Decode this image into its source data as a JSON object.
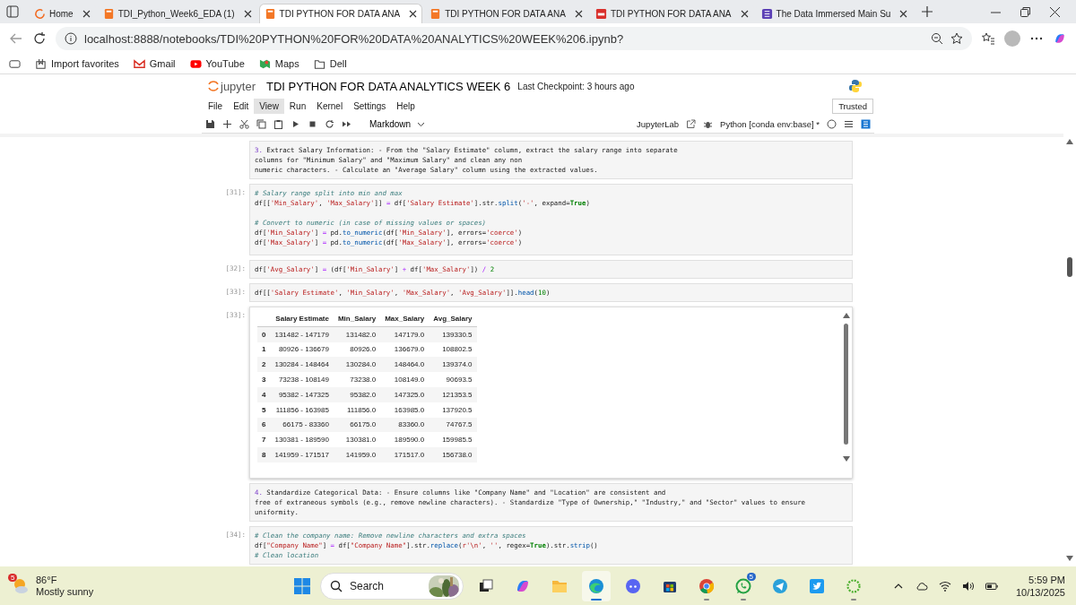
{
  "browser": {
    "tabs": [
      {
        "title": "Home",
        "kind": "home",
        "selected": false
      },
      {
        "title": "TDI_Python_Week6_EDA (1)",
        "kind": "notebook",
        "selected": false
      },
      {
        "title": "TDI PYTHON FOR DATA ANA",
        "kind": "notebook",
        "selected": true
      },
      {
        "title": "TDI PYTHON FOR DATA ANA",
        "kind": "notebook",
        "selected": false
      },
      {
        "title": "TDI PYTHON FOR DATA ANA",
        "kind": "pdf",
        "selected": false
      },
      {
        "title": "The Data Immersed Main Su",
        "kind": "doc",
        "selected": false
      }
    ],
    "url": "localhost:8888/notebooks/TDI%20PYTHON%20FOR%20DATA%20ANALYTICS%20WEEK%206.ipynb?",
    "favorites": [
      {
        "label": "Import favorites",
        "kind": "import"
      },
      {
        "label": "Gmail",
        "kind": "gmail"
      },
      {
        "label": "YouTube",
        "kind": "youtube"
      },
      {
        "label": "Maps",
        "kind": "maps"
      },
      {
        "label": "Dell",
        "kind": "folder"
      }
    ]
  },
  "jupyter": {
    "logo": "jupyter",
    "title": "TDI PYTHON FOR DATA ANALYTICS WEEK 6",
    "checkpoint": "Last Checkpoint: 3 hours ago",
    "menu": [
      {
        "label": "File",
        "selected": false
      },
      {
        "label": "Edit",
        "selected": false
      },
      {
        "label": "View",
        "selected": true
      },
      {
        "label": "Run",
        "selected": false
      },
      {
        "label": "Kernel",
        "selected": false
      },
      {
        "label": "Settings",
        "selected": false
      },
      {
        "label": "Help",
        "selected": false
      }
    ],
    "trusted": "Trusted",
    "cell_type": "Markdown",
    "open_in": "JupyterLab",
    "kernel": "Python [conda env:base] *"
  },
  "cells": [
    {
      "kind": "markdown",
      "lines": [
        "3. Extract Salary Information: - From the \"Salary Estimate\" column, extract the salary range into separate",
        "columns for \"Minimum Salary\" and \"Maximum Salary\" and clean any non",
        "numeric characters. - Calculate an \"Average Salary\" column using the extracted values."
      ]
    },
    {
      "kind": "code",
      "prompt": "[31]:",
      "groups": [
        [
          "# Salary range split into min and max",
          "df[['Min_Salary', 'Max_Salary']] = df['Salary Estimate'].str.split('-', expand=True)"
        ],
        [
          "# Convert to numeric (in case of missing values or spaces)",
          "df['Min_Salary'] = pd.to_numeric(df['Min_Salary'], errors='coerce')",
          "df['Max_Salary'] = pd.to_numeric(df['Max_Salary'], errors='coerce')"
        ]
      ]
    },
    {
      "kind": "code",
      "prompt": "[32]:",
      "groups": [
        [
          "df['Avg_Salary'] = (df['Min_Salary'] + df['Max_Salary']) / 2"
        ]
      ]
    },
    {
      "kind": "code",
      "prompt": "[33]:",
      "groups": [
        [
          "df[['Salary Estimate', 'Min_Salary', 'Max_Salary', 'Avg_Salary']].head(10)"
        ]
      ]
    },
    {
      "kind": "table",
      "prompt": "[33]:",
      "columns": [
        "",
        "Salary Estimate",
        "Min_Salary",
        "Max_Salary",
        "Avg_Salary"
      ],
      "rows": [
        [
          "0",
          "131482 - 147179",
          "131482.0",
          "147179.0",
          "139330.5"
        ],
        [
          "1",
          "80926 - 136679",
          "80926.0",
          "136679.0",
          "108802.5"
        ],
        [
          "2",
          "130284 - 148464",
          "130284.0",
          "148464.0",
          "139374.0"
        ],
        [
          "3",
          "73238 - 108149",
          "73238.0",
          "108149.0",
          "90693.5"
        ],
        [
          "4",
          "95382 - 147325",
          "95382.0",
          "147325.0",
          "121353.5"
        ],
        [
          "5",
          "111856 - 163985",
          "111856.0",
          "163985.0",
          "137920.5"
        ],
        [
          "6",
          "66175 - 83360",
          "66175.0",
          "83360.0",
          "74767.5"
        ],
        [
          "7",
          "130381 - 189590",
          "130381.0",
          "189590.0",
          "159985.5"
        ],
        [
          "8",
          "141959 - 171517",
          "141959.0",
          "171517.0",
          "156738.0"
        ]
      ]
    },
    {
      "kind": "markdown",
      "lines": [
        "4. Standardize Categorical Data: - Ensure columns like \"Company Name\" and \"Location\" are consistent and",
        "free of extraneous symbols (e.g., remove newline characters). - Standardize \"Type of Ownership,\" \"Industry,\" and \"Sector\" values to ensure",
        "uniformity."
      ]
    },
    {
      "kind": "code",
      "prompt": "[34]:",
      "groups": [
        [
          "# Clean the company name: Remove newline characters and extra spaces",
          "df[\"Company Name\"] = df[\"Company Name\"].str.replace(r'\\n', '', regex=True).str.strip()",
          "# Clean location"
        ]
      ]
    }
  ],
  "taskbar": {
    "weather": {
      "badge": "5",
      "temp": "86°F",
      "condition": "Mostly sunny"
    },
    "search": {
      "placeholder": "Search"
    },
    "apps": [
      {
        "kind": "taskview",
        "active": false,
        "running": false
      },
      {
        "kind": "copilot",
        "active": false,
        "running": false
      },
      {
        "kind": "explorer",
        "active": false,
        "running": false
      },
      {
        "kind": "edge",
        "active": true,
        "running": true
      },
      {
        "kind": "discord",
        "active": false,
        "running": false
      },
      {
        "kind": "store",
        "active": false,
        "running": false
      },
      {
        "kind": "chrome",
        "active": false,
        "running": true
      },
      {
        "kind": "whatsapp",
        "active": false,
        "running": true,
        "badge": "5"
      },
      {
        "kind": "telegram",
        "active": false,
        "running": false
      },
      {
        "kind": "twitter",
        "active": false,
        "running": false
      },
      {
        "kind": "ring",
        "active": false,
        "running": true
      }
    ],
    "time": "5:59 PM",
    "date": "10/13/2025"
  }
}
